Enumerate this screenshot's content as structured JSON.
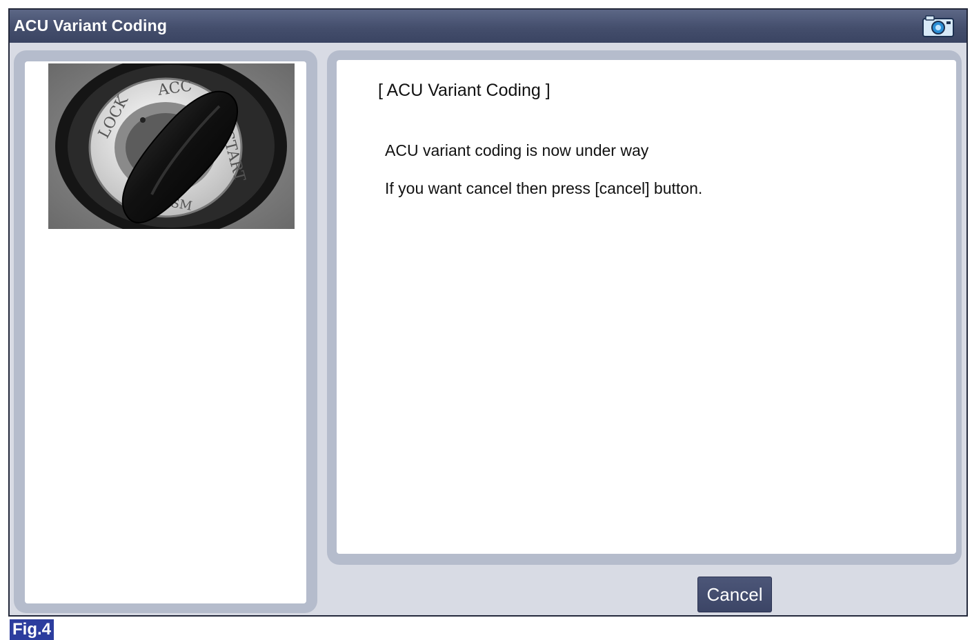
{
  "window": {
    "title": "ACU Variant Coding",
    "camera_icon": "camera-icon"
  },
  "image_panel": {
    "icon": "ignition-key-icon",
    "key_positions": [
      "LOCK",
      "ACC",
      "START",
      "USM"
    ]
  },
  "content": {
    "title": "[ ACU Variant Coding ]",
    "message_line1": "ACU variant coding is now under way",
    "message_line2": "If you want cancel then press [cancel] button."
  },
  "buttons": {
    "cancel_label": "Cancel"
  },
  "figure_label": "Fig.4",
  "colors": {
    "titlebar": "#444e6c",
    "panel_frame": "#b5bccc",
    "button": "#3c4566",
    "figure_badge": "#2c3d9e"
  }
}
